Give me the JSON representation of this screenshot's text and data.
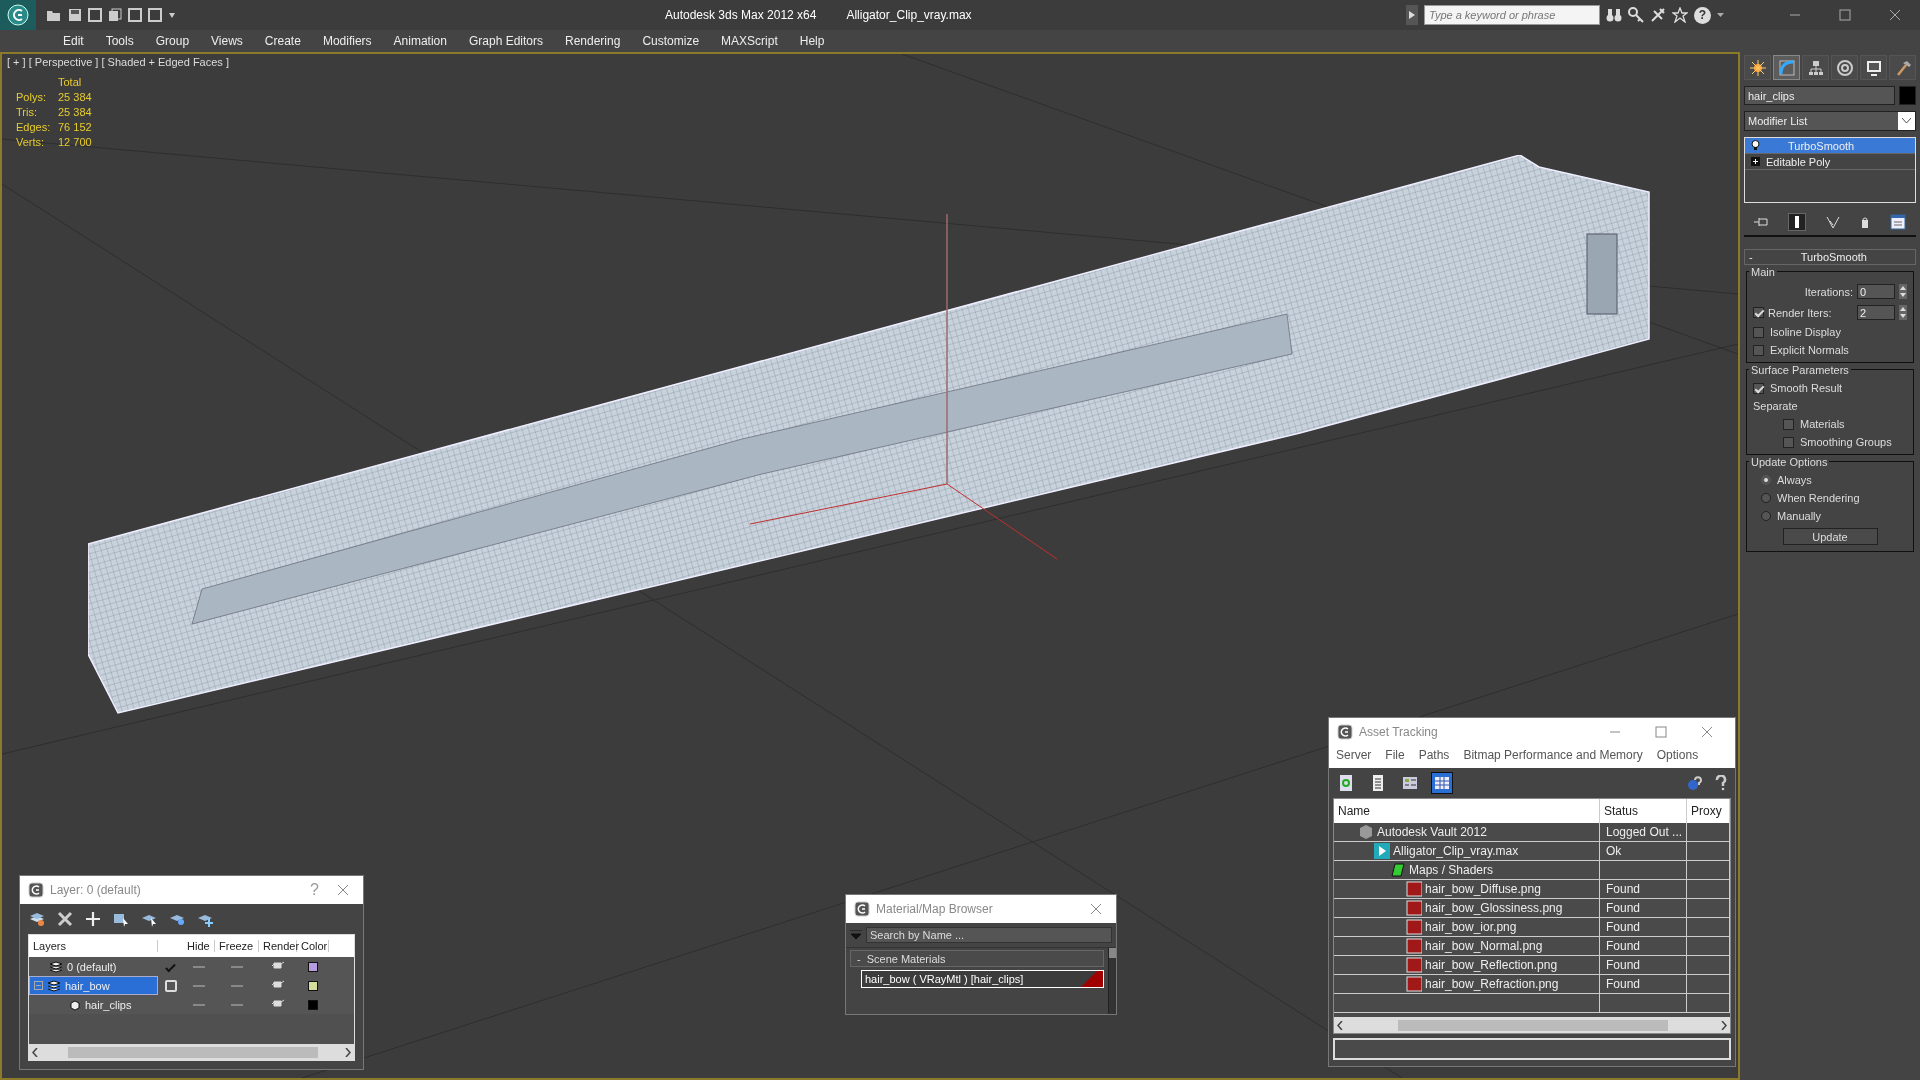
{
  "title_bar": {
    "app_title": "Autodesk 3ds Max  2012 x64",
    "file_name": "Alligator_Clip_vray.max",
    "search": {
      "placeholder": "Type a keyword or phrase"
    },
    "help": "?"
  },
  "menu": [
    "Edit",
    "Tools",
    "Group",
    "Views",
    "Create",
    "Modifiers",
    "Animation",
    "Graph Editors",
    "Rendering",
    "Customize",
    "MAXScript",
    "Help"
  ],
  "viewport": {
    "label": "[ + ] [ Perspective ] [ Shaded + Edged Faces ]",
    "stats": {
      "header": "Total",
      "rows": [
        {
          "label": "Polys:",
          "value": "25 384"
        },
        {
          "label": "Tris:",
          "value": "25 384"
        },
        {
          "label": "Edges:",
          "value": "76 152"
        },
        {
          "label": "Verts:",
          "value": "12 700"
        }
      ]
    }
  },
  "command_panel": {
    "tabs": [
      {
        "kind": "create",
        "selected": false
      },
      {
        "kind": "modify",
        "selected": true
      },
      {
        "kind": "hierarchy",
        "selected": false
      },
      {
        "kind": "motion",
        "selected": false
      },
      {
        "kind": "display",
        "selected": false
      },
      {
        "kind": "utilities",
        "selected": false
      }
    ],
    "object_name": "hair_clips",
    "modifier_list": "Modifier List",
    "stack": [
      {
        "label": "TurboSmooth",
        "kind": "modifier",
        "selected": true
      },
      {
        "label": "Editable Poly",
        "kind": "base",
        "selected": false
      }
    ],
    "rollout": {
      "title": "TurboSmooth",
      "collapse": "-",
      "main": {
        "title": "Main",
        "iterations": {
          "label": "Iterations:",
          "value": "0"
        },
        "render_iters": {
          "label": "Render Iters:",
          "value": "2",
          "checked": true
        },
        "checks": [
          {
            "label": "Isoline Display",
            "checked": false
          },
          {
            "label": "Explicit Normals",
            "checked": false
          }
        ]
      },
      "surface": {
        "title": "Surface Parameters",
        "smooth_result": {
          "label": "Smooth Result",
          "checked": true
        },
        "separate_label": "Separate",
        "separate": [
          {
            "label": "Materials",
            "checked": false
          },
          {
            "label": "Smoothing Groups",
            "checked": false
          }
        ]
      },
      "update": {
        "title": "Update Options",
        "options": [
          {
            "label": "Always",
            "selected": true
          },
          {
            "label": "When Rendering",
            "selected": false
          },
          {
            "label": "Manually",
            "selected": false
          }
        ],
        "button": "Update"
      }
    }
  },
  "layer_dialog": {
    "title": "Layer: 0 (default)",
    "help": "?",
    "columns": [
      "Layers",
      "Hide",
      "Freeze",
      "Render",
      "Color"
    ],
    "rows": [
      {
        "name": "0 (default)",
        "kind": "layer",
        "current": true,
        "selected": false,
        "color": "#b59ee0"
      },
      {
        "name": "hair_bow",
        "kind": "layer",
        "current": false,
        "selected": true,
        "color": "#d6dc9a",
        "children": [
          {
            "name": "hair_clips",
            "kind": "object",
            "selected": false,
            "color": "#000000"
          }
        ]
      }
    ]
  },
  "material_browser": {
    "title": "Material/Map Browser",
    "search": {
      "placeholder": "Search by Name ..."
    },
    "group": {
      "title": "Scene Materials",
      "collapse": "-",
      "items": [
        {
          "label": "hair_bow  ( VRayMtl ) [hair_clips]",
          "selected": true
        }
      ]
    }
  },
  "asset_tracking": {
    "title": "Asset Tracking",
    "menu": [
      "Server",
      "File",
      "Paths",
      "Bitmap Performance and Memory",
      "Options"
    ],
    "view_buttons": [
      {
        "kind": "refresh",
        "selected": false
      },
      {
        "kind": "list",
        "selected": false
      },
      {
        "kind": "thumbnails",
        "selected": false
      },
      {
        "kind": "table",
        "selected": true
      }
    ],
    "columns": [
      "Name",
      "Status",
      "Proxy"
    ],
    "rows": [
      {
        "name": "Autodesk Vault 2012",
        "kind": "vault",
        "status": "Logged Out ...",
        "children": [
          {
            "name": "Alligator_Clip_vray.max",
            "kind": "scene",
            "status": "Ok",
            "children": [
              {
                "name": "Maps / Shaders",
                "kind": "folder",
                "children": [
                  {
                    "name": "hair_bow_Diffuse.png",
                    "kind": "png",
                    "status": "Found"
                  },
                  {
                    "name": "hair_bow_Glossiness.png",
                    "kind": "png",
                    "status": "Found"
                  },
                  {
                    "name": "hair_bow_ior.png",
                    "kind": "png",
                    "status": "Found"
                  },
                  {
                    "name": "hair_bow_Normal.png",
                    "kind": "png",
                    "status": "Found"
                  },
                  {
                    "name": "hair_bow_Reflection.png",
                    "kind": "png",
                    "status": "Found"
                  },
                  {
                    "name": "hair_bow_Refraction.png",
                    "kind": "png",
                    "status": "Found"
                  }
                ]
              }
            ]
          }
        ]
      }
    ]
  }
}
